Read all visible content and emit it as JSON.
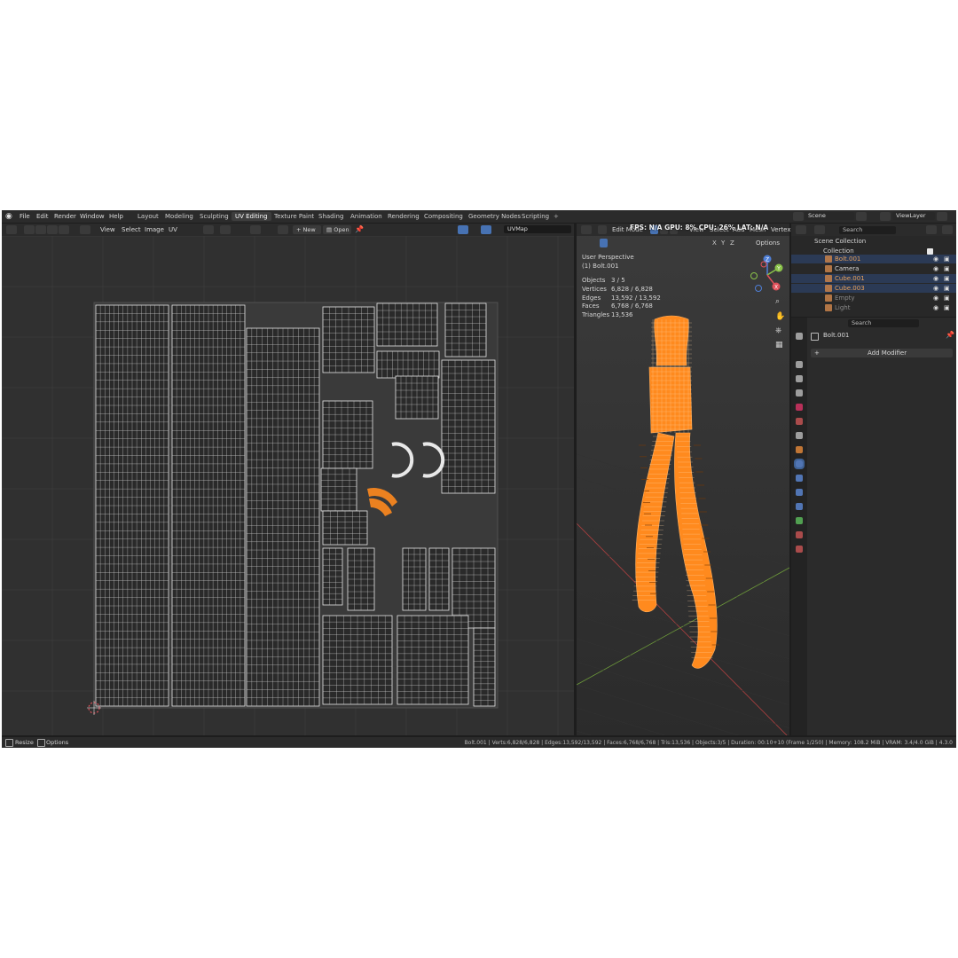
{
  "topbar": {
    "menus": [
      "File",
      "Edit",
      "Render",
      "Window",
      "Help"
    ],
    "workspaces": [
      "Layout",
      "Modeling",
      "Sculpting",
      "UV Editing",
      "Texture Paint",
      "Shading",
      "Animation",
      "Rendering",
      "Compositing",
      "Geometry Nodes",
      "Scripting"
    ],
    "active_workspace": "UV Editing",
    "add_tab": "+",
    "scene_label": "Scene",
    "viewlayer_label": "ViewLayer"
  },
  "uv_editor": {
    "menus": [
      "View",
      "Select",
      "Image",
      "UV"
    ],
    "new_button": "New",
    "open_button": "Open",
    "uvmap_value": "UVMap"
  },
  "viewport": {
    "mode": "Edit Mode",
    "menus": [
      "View",
      "Select",
      "Add",
      "Mesh",
      "Vertex"
    ],
    "xyz": [
      "X",
      "Y",
      "Z"
    ],
    "options": "Options",
    "overlay_fps": "FPS: N/A  GPU: 8%  CPU: 26%  LAT: N/A",
    "perspective": "User Perspective",
    "object_label": "(1) Bolt.001",
    "stats": [
      {
        "label": "Objects",
        "value": "3 / 5"
      },
      {
        "label": "Vertices",
        "value": "6,828 / 6,828"
      },
      {
        "label": "Edges",
        "value": "13,592 / 13,592"
      },
      {
        "label": "Faces",
        "value": "6,768 / 6,768"
      },
      {
        "label": "Triangles",
        "value": "13,536"
      }
    ],
    "gizmo_axes": [
      "X",
      "Y",
      "Z"
    ]
  },
  "outliner": {
    "search_placeholder": "Search",
    "root": "Scene Collection",
    "collection": "Collection",
    "items": [
      {
        "name": "Bolt.001",
        "selected": true,
        "color": "#e8a25e"
      },
      {
        "name": "Camera",
        "selected": false,
        "color": "#d6d6d6"
      },
      {
        "name": "Cube.001",
        "selected": true,
        "color": "#e8a25e"
      },
      {
        "name": "Cube.003",
        "selected": true,
        "color": "#e8a25e"
      },
      {
        "name": "Empty",
        "selected": false,
        "color": "#8a8a8a"
      },
      {
        "name": "Light",
        "selected": false,
        "color": "#8a8a8a"
      }
    ]
  },
  "properties": {
    "search_placeholder": "Search",
    "object_name": "Bolt.001",
    "add_modifier": "Add Modifier"
  },
  "statusbar": {
    "left_resize": "Resize",
    "left_options": "Options",
    "right_text": "Bolt.001 | Verts:6,828/6,828 | Edges:13,592/13,592 | Faces:6,768/6,768 | Tris:13,536 | Objects:3/5 | Duration: 00:10+10 (Frame 1/250) | Memory: 108.2 MiB | VRAM: 3.4/4.0 GiB | 4.3.0"
  },
  "colors": {
    "accent_orange": "#ff8a1e",
    "selection_blue": "#4772b3",
    "background": "#1d1d1d"
  }
}
